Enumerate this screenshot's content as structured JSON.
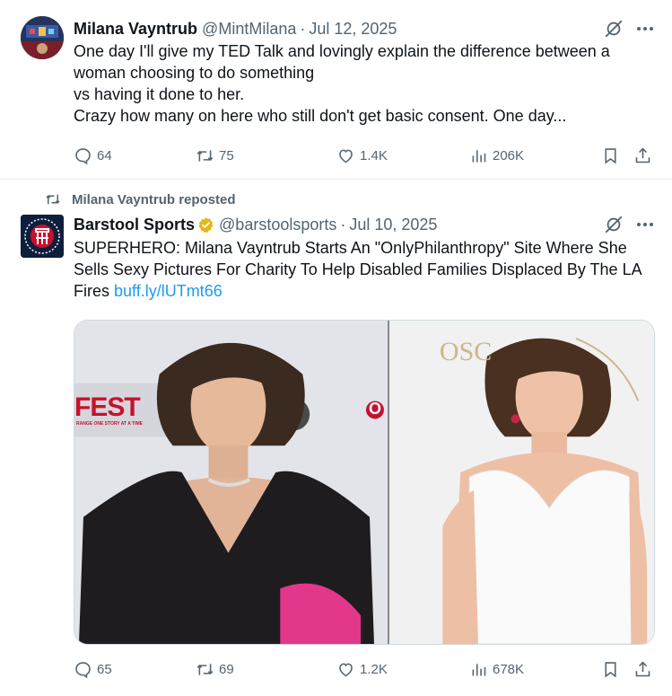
{
  "tweet1": {
    "author_name": "Milana Vayntrub",
    "author_handle": "@MintMilana",
    "separator": "·",
    "date": "Jul 12, 2025",
    "text": "One day I'll give my TED Talk and lovingly explain the  difference between a woman choosing to do something\nvs having it done to her.\nCrazy how many on here who still don't get basic consent. One day...",
    "stats": {
      "replies": "64",
      "reposts": "75",
      "likes": "1.4K",
      "views": "206K"
    }
  },
  "tweet2": {
    "repost_label": "Milana Vayntrub reposted",
    "author_name": "Barstool Sports",
    "author_handle": "@barstoolsports",
    "separator": "·",
    "date": "Jul 10, 2025",
    "text": "SUPERHERO: Milana Vayntrub Starts An \"OnlyPhilanthropy\" Site Where She Sells Sexy Pictures For Charity To Help Disabled Families Displaced By The LA Fires ",
    "link_text": "buff.ly/lUTmt66",
    "media": {
      "left_backdrop_text": "FEST",
      "left_backdrop_subtext": "RANGE ONE STORY AT A TIME",
      "left_backdrop_letter": "O",
      "right_backdrop_text": "OSC"
    },
    "stats": {
      "replies": "65",
      "reposts": "69",
      "likes": "1.2K",
      "views": "678K"
    }
  },
  "colors": {
    "text": "#0f1419",
    "secondary": "#536471",
    "link": "#1d9bf0",
    "verified": "#e2b719",
    "divider": "#e6ecf0"
  },
  "icons": [
    "grok-icon",
    "more-icon",
    "reply-icon",
    "retweet-icon",
    "like-icon",
    "views-icon",
    "bookmark-icon",
    "share-icon",
    "verified-badge-icon"
  ]
}
